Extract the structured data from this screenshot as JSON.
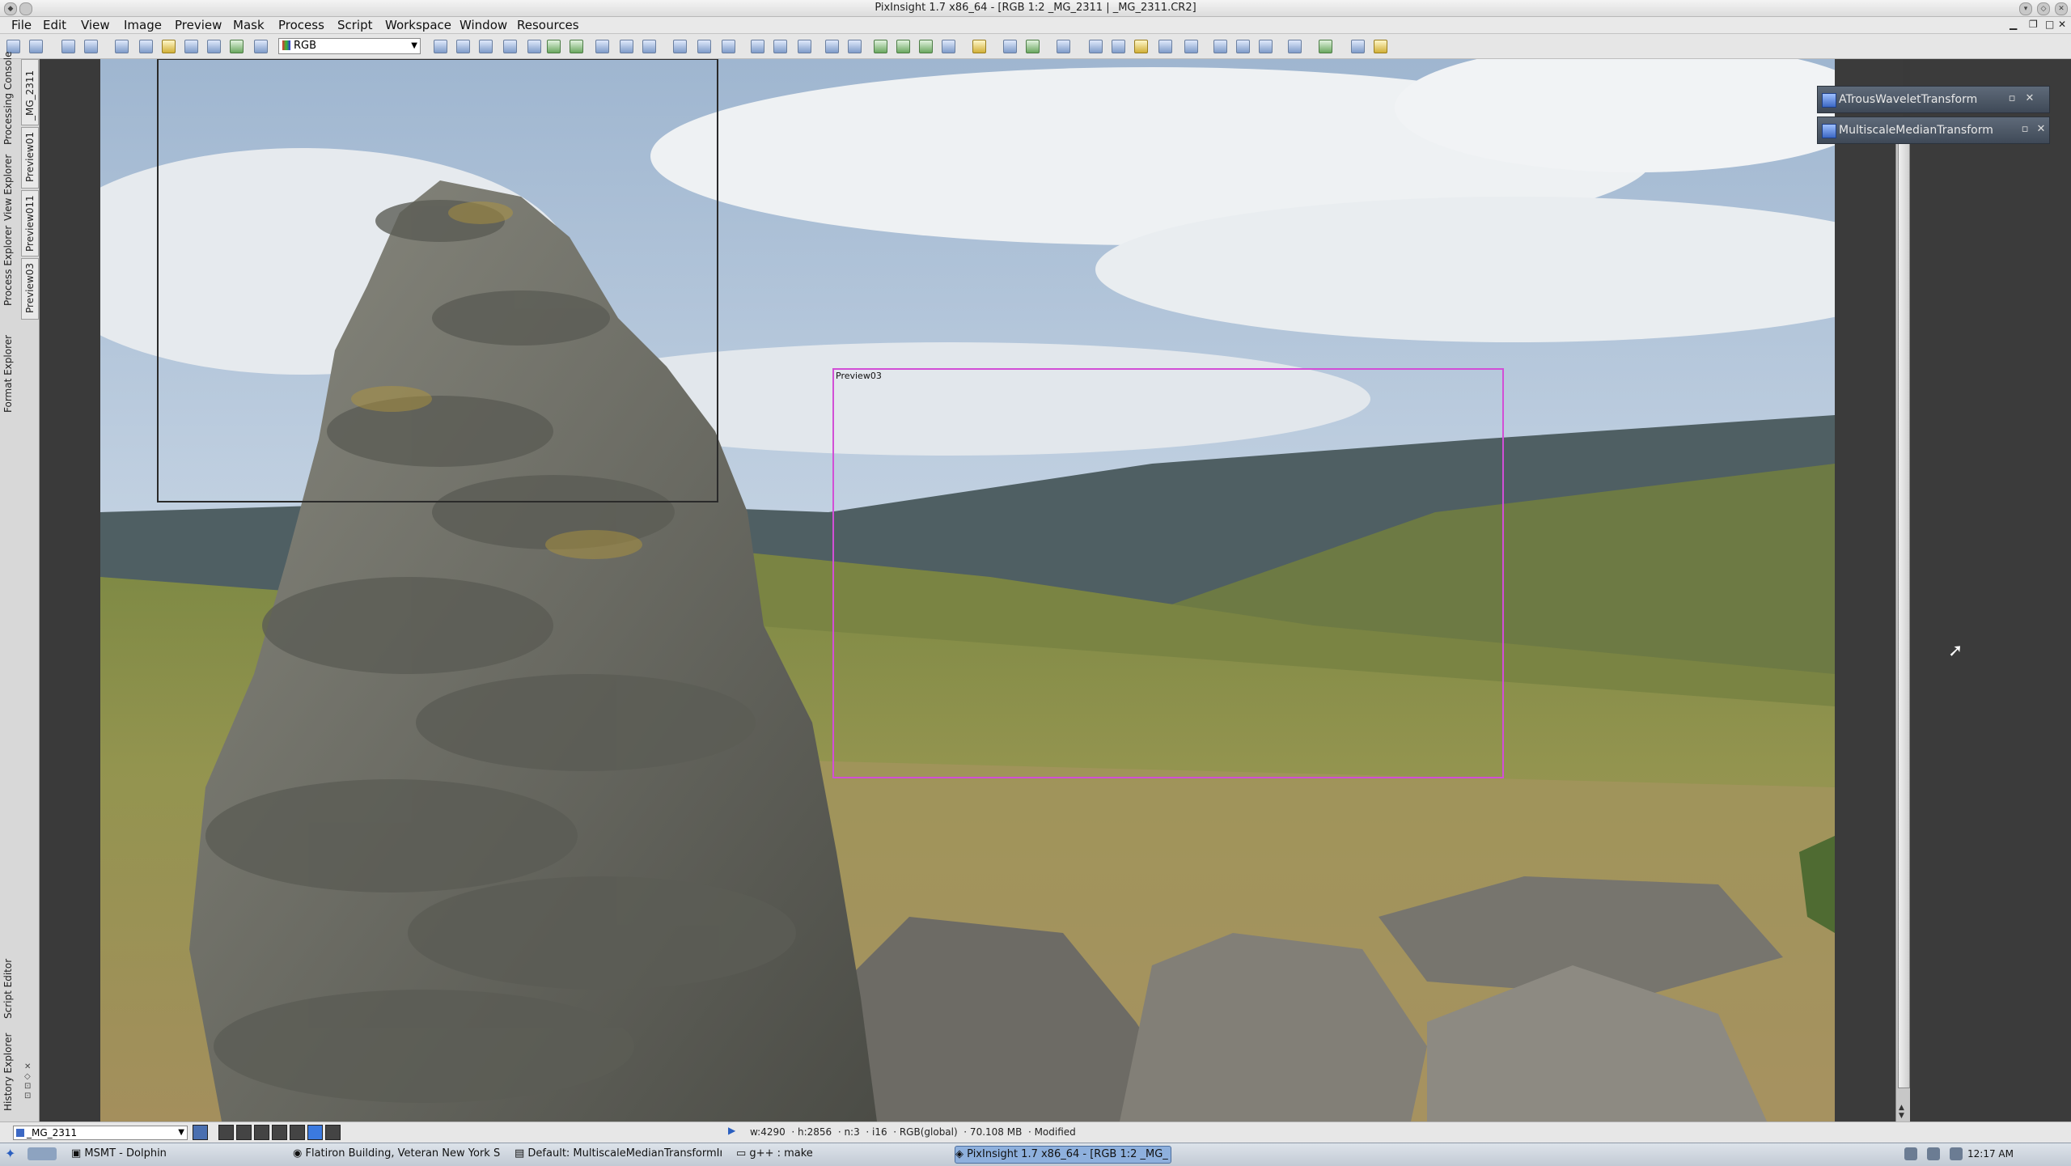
{
  "window": {
    "title": "PixInsight 1.7 x86_64 - [RGB 1:2 _MG_2311 | _MG_2311.CR2]"
  },
  "menu": {
    "items": [
      "File",
      "Edit",
      "View",
      "Image",
      "Preview",
      "Mask",
      "Process",
      "Script",
      "Workspace",
      "Window",
      "Resources"
    ]
  },
  "toolbar": {
    "color_mode": "RGB"
  },
  "left_dock": {
    "top_tabs": [
      "Processing Console",
      "View Explorer",
      "Process Explorer",
      "Format Explorer"
    ],
    "view_tabs": [
      "_MG_2311",
      "Preview01",
      "Preview011",
      "Preview03"
    ],
    "bottom_tabs": [
      "Script Editor",
      "History Explorer"
    ]
  },
  "image": {
    "preview_label": "Preview03"
  },
  "shaded_windows": [
    {
      "label": "ATrousWaveletTransform"
    },
    {
      "label": "MultiscaleMedianTransform"
    }
  ],
  "statusbar": {
    "view_name": "_MG_2311",
    "info": "w:4290  · h:2856  · n:3  · i16  · RGB(global)  · 70.108 MB  · Modified"
  },
  "taskbar": {
    "tasks": [
      "MSMT - Dolphin",
      "Flatiron Building, Veteran New York Sky",
      "Default: MultiscaleMedianTransformInst",
      "g++ : make",
      "PixInsight 1.7 x86_64 - [RGB 1:2 _MG_"
    ],
    "clock": "12:17 AM"
  },
  "colors": {
    "preview_outline": "#d24fd6",
    "panel_bg": "#3b3b3b"
  }
}
